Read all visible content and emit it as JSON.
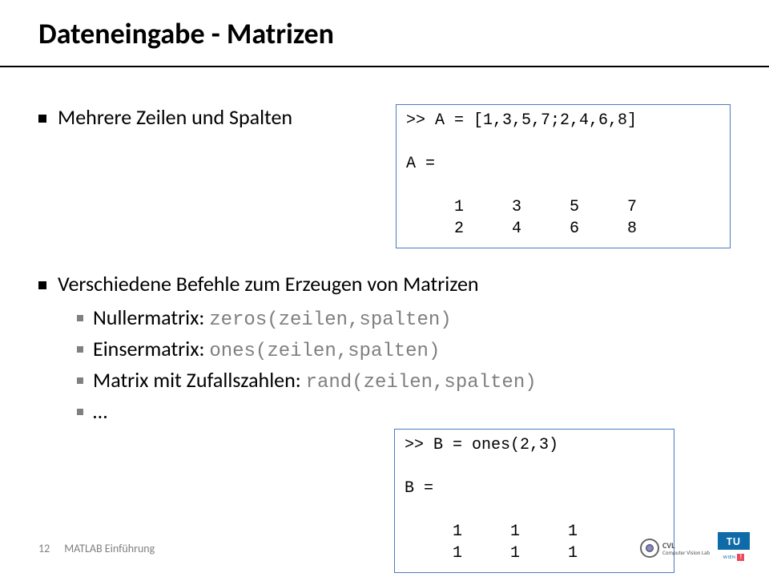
{
  "title": "Dateneingabe - Matrizen",
  "bullets": {
    "b1": "Mehrere Zeilen und Spalten",
    "b2": "Verschiedene Befehle zum Erzeugen von Matrizen",
    "s1_label": "Nullermatrix: ",
    "s1_code": "zeros(zeilen,spalten)",
    "s2_label": "Einsermatrix: ",
    "s2_code": "ones(zeilen,spalten)",
    "s3_label": "Matrix mit Zufallszahlen: ",
    "s3_code": "rand(zeilen,spalten)",
    "s4": "…"
  },
  "codebox1": ">> A = [1,3,5,7;2,4,6,8]\n\nA =\n\n     1     3     5     7\n     2     4     6     8",
  "codebox2": ">> B = ones(2,3)\n\nB =\n\n     1     1     1\n     1     1     1",
  "footer": {
    "page": "12",
    "label": "MATLAB Einführung"
  },
  "logos": {
    "cvl_line1": "CVL",
    "cvl_line2": "Computer Vision Lab",
    "tuw_top": "TU",
    "tuw_wien": "WIEN",
    "tuw_mark": "!"
  }
}
